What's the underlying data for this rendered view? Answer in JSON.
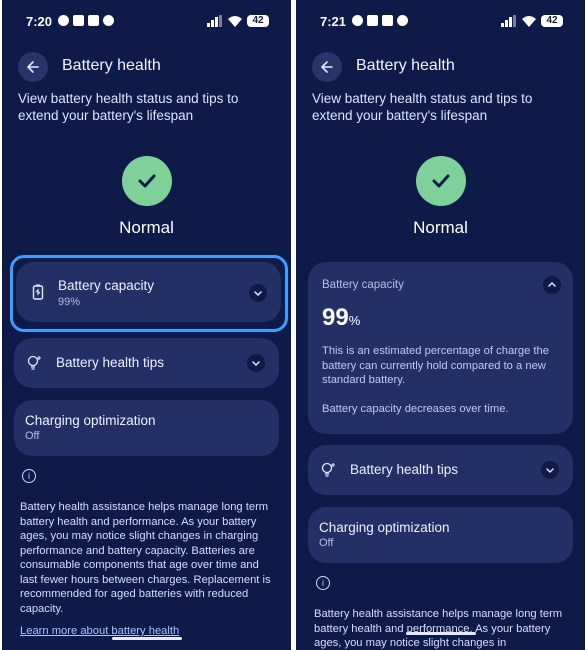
{
  "left": {
    "status_time": "7:20",
    "battery_level": "42",
    "header_title": "Battery health",
    "subtitle": "View battery health status and tips to extend your battery's lifespan",
    "status_text": "Normal",
    "capacity_card": {
      "title": "Battery capacity",
      "value": "99%"
    },
    "tips_card": {
      "title": "Battery health tips"
    },
    "charging_card": {
      "title": "Charging optimization",
      "value": "Off"
    },
    "footer_text": "Battery health assistance helps manage long term battery health and performance. As your battery ages, you may notice slight changes in charging performance and battery capacity. Batteries are consumable components that age over time and last fewer hours between charges. Replacement is recommended for aged batteries with reduced capacity.",
    "link_text": "Learn more about battery health"
  },
  "right": {
    "status_time": "7:21",
    "battery_level": "42",
    "header_title": "Battery health",
    "subtitle": "View battery health status and tips to extend your battery's lifespan",
    "status_text": "Normal",
    "capacity_card": {
      "title": "Battery capacity",
      "value_number": "99",
      "value_unit": "%",
      "description": "This is an estimated percentage of charge the battery can currently hold compared to a new standard battery.",
      "note": "Battery capacity decreases over time."
    },
    "tips_card": {
      "title": "Battery health tips"
    },
    "charging_card": {
      "title": "Charging optimization",
      "value": "Off"
    },
    "footer_text": "Battery health assistance helps manage long term battery health and performance. As your battery ages, you may notice slight changes in"
  },
  "colors": {
    "background": "#0e1a47",
    "card": "#223066",
    "status_ok": "#7fd19a",
    "focus_ring": "#3aa0ff",
    "link": "#a9c4ff"
  },
  "icons": [
    "back-arrow-icon",
    "check-icon",
    "battery-sync-icon",
    "chevron-down-icon",
    "chevron-up-icon",
    "lightbulb-icon",
    "info-icon"
  ]
}
